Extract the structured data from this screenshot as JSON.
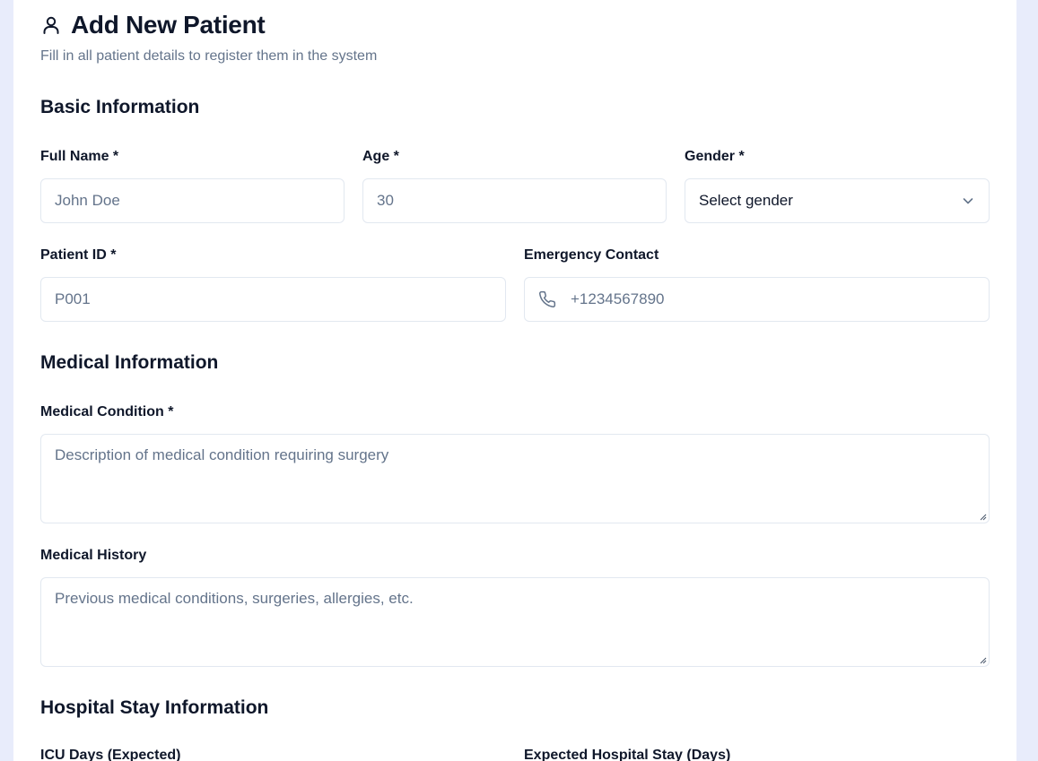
{
  "header": {
    "title": "Add New Patient",
    "subtitle": "Fill in all patient details to register them in the system"
  },
  "sections": {
    "basic": "Basic Information",
    "medical": "Medical Information",
    "stay": "Hospital Stay Information"
  },
  "fields": {
    "full_name": {
      "label": "Full Name *",
      "placeholder": "John Doe"
    },
    "age": {
      "label": "Age *",
      "placeholder": "30"
    },
    "gender": {
      "label": "Gender *",
      "value": "Select gender"
    },
    "patient_id": {
      "label": "Patient ID *",
      "placeholder": "P001"
    },
    "emergency_contact": {
      "label": "Emergency Contact",
      "placeholder": "+1234567890"
    },
    "medical_condition": {
      "label": "Medical Condition *",
      "placeholder": "Description of medical condition requiring surgery"
    },
    "medical_history": {
      "label": "Medical History",
      "placeholder": "Previous medical conditions, surgeries, allergies, etc."
    },
    "icu_days": {
      "label": "ICU Days (Expected)"
    },
    "hospital_stay": {
      "label": "Expected Hospital Stay (Days)"
    }
  },
  "icons": {
    "title": "user-icon",
    "gender": "chevron-down-icon",
    "phone": "phone-icon"
  },
  "colors": {
    "page_bg": "#e8ecfb",
    "card_bg": "#ffffff",
    "text": "#0f172a",
    "muted": "#64748b",
    "border": "#e2e8f0"
  }
}
